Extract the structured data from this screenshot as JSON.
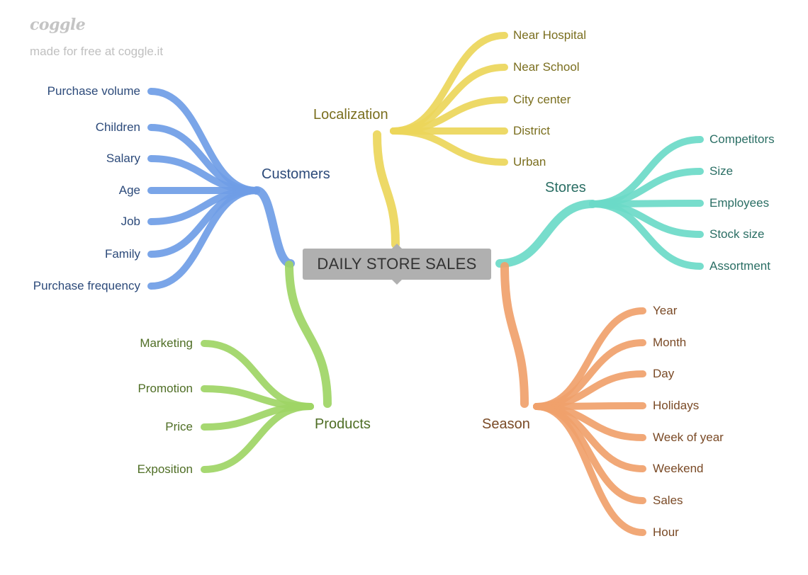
{
  "watermark": {
    "logo": "coggle",
    "tagline": "made for free at coggle.it"
  },
  "center": {
    "label": "DAILY STORE SALES"
  },
  "colors": {
    "customers": "#6f9de6",
    "customers_text": "#2c4a7a",
    "localization": "#ebd65a",
    "localization_text": "#7a6e1e",
    "stores": "#6bdac8",
    "stores_text": "#2a6e64",
    "products": "#9ed565",
    "products_text": "#4f6e25",
    "season": "#f0a16b",
    "season_text": "#7a4a26"
  },
  "branches": {
    "customers": {
      "label": "Customers",
      "items": [
        "Purchase volume",
        "Children",
        "Salary",
        "Age",
        "Job",
        "Family",
        "Purchase frequency"
      ]
    },
    "localization": {
      "label": "Localization",
      "items": [
        "Near Hospital",
        "Near School",
        "City center",
        "District",
        "Urban"
      ]
    },
    "stores": {
      "label": "Stores",
      "items": [
        "Competitors",
        "Size",
        "Employees",
        "Stock size",
        "Assortment"
      ]
    },
    "products": {
      "label": "Products",
      "items": [
        "Marketing",
        "Promotion",
        "Price",
        "Exposition"
      ]
    },
    "season": {
      "label": "Season",
      "items": [
        "Year",
        "Month",
        "Day",
        "Holidays",
        "Week of year",
        "Weekend",
        "Sales",
        "Hour"
      ]
    }
  }
}
